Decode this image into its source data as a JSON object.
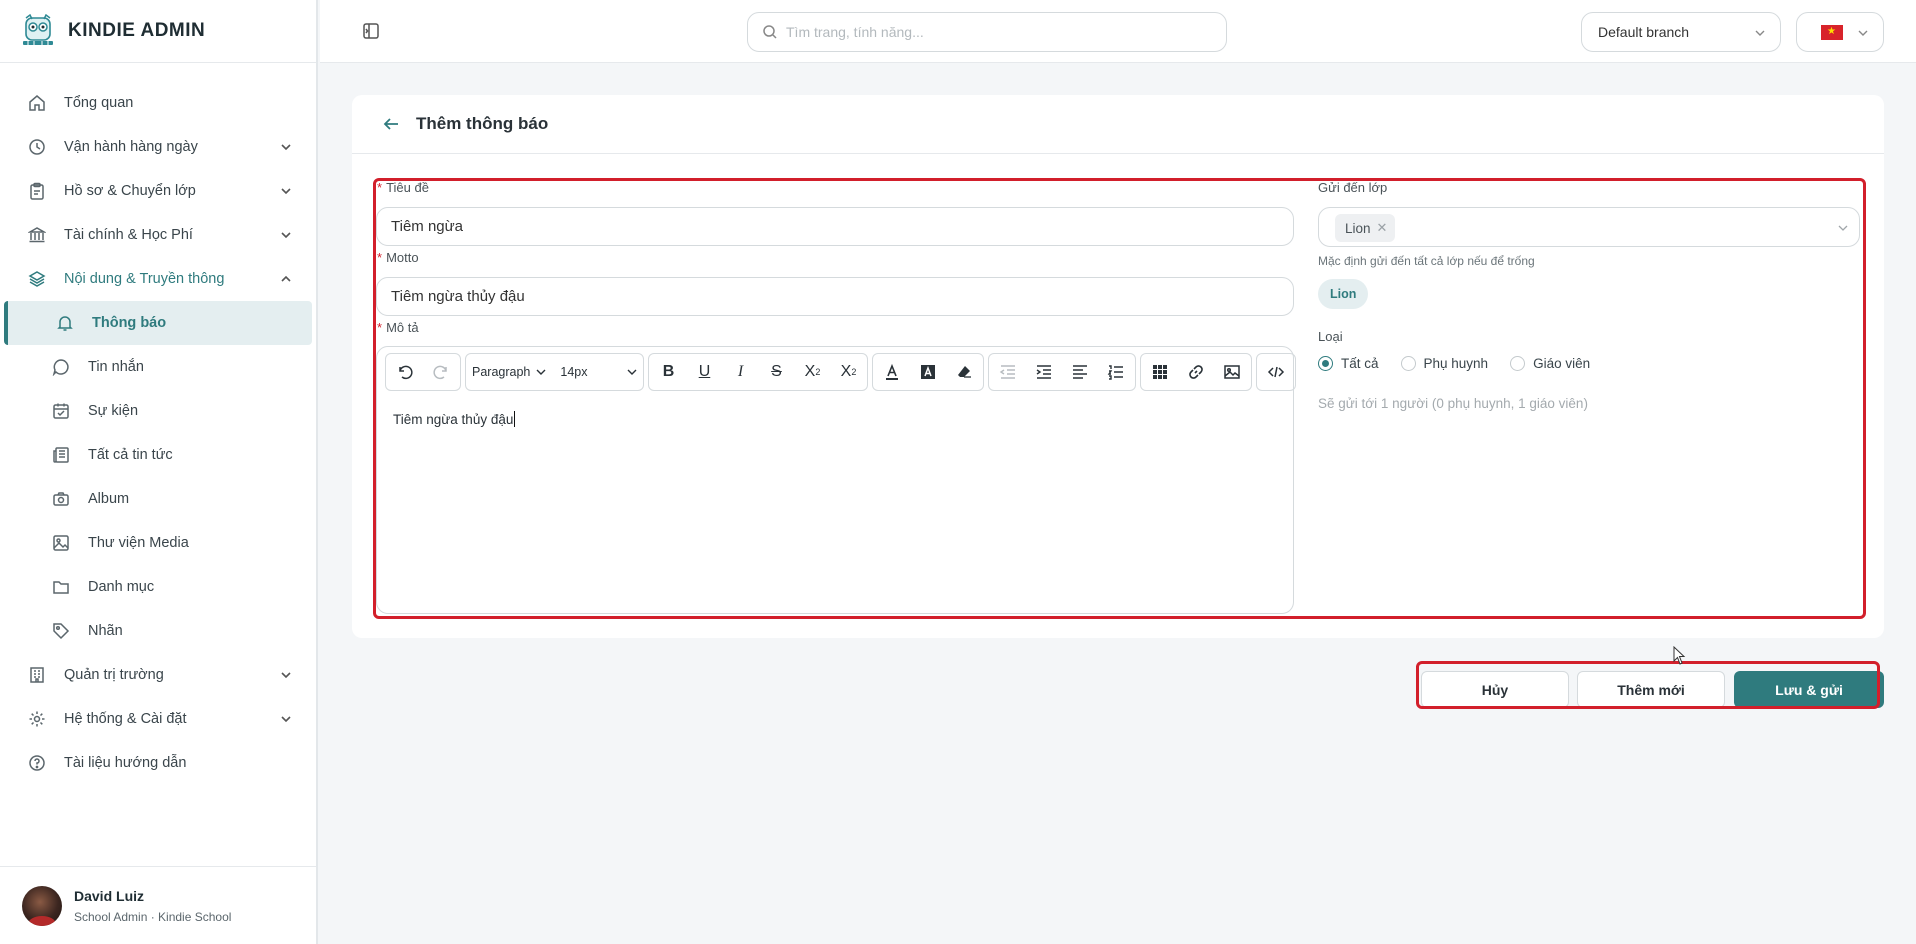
{
  "app": {
    "name": "KINDIE ADMIN"
  },
  "sidebar": {
    "items": [
      {
        "label": "Tổng quan",
        "icon": "home-icon",
        "expandable": false
      },
      {
        "label": "Vận hành hàng ngày",
        "icon": "clock-icon",
        "expandable": true
      },
      {
        "label": "Hồ sơ & Chuyển lớp",
        "icon": "clipboard-icon",
        "expandable": true
      },
      {
        "label": "Tài chính & Học Phí",
        "icon": "bank-icon",
        "expandable": true
      },
      {
        "label": "Nội dung & Truyền thông",
        "icon": "layers-icon",
        "expandable": true,
        "open": true
      }
    ],
    "sub_items": [
      {
        "label": "Thông báo",
        "icon": "bell-icon",
        "active": true
      },
      {
        "label": "Tin nhắn",
        "icon": "message-icon"
      },
      {
        "label": "Sự kiện",
        "icon": "calendar-icon"
      },
      {
        "label": "Tất cả tin tức",
        "icon": "newspaper-icon"
      },
      {
        "label": "Album",
        "icon": "camera-icon"
      },
      {
        "label": "Thư viện Media",
        "icon": "image-icon"
      },
      {
        "label": "Danh mục",
        "icon": "folder-icon"
      },
      {
        "label": "Nhãn",
        "icon": "tag-icon"
      }
    ],
    "bottom_items": [
      {
        "label": "Quản trị trường",
        "icon": "building-icon",
        "expandable": true
      },
      {
        "label": "Hệ thống & Cài đặt",
        "icon": "gear-icon",
        "expandable": true
      },
      {
        "label": "Tài liệu hướng dẫn",
        "icon": "help-circle-icon",
        "expandable": false
      }
    ],
    "user": {
      "name": "David Luiz",
      "role": "School Admin · Kindie School"
    }
  },
  "topbar": {
    "search_placeholder": "Tìm trang, tính năng...",
    "branch": "Default branch",
    "language_flag": "vietnam-flag-icon"
  },
  "form": {
    "title": "Thêm thông báo",
    "title_label": "Tiêu đề",
    "title_value": "Tiêm ngừa",
    "motto_label": "Motto",
    "motto_value": "Tiêm ngừa thủy đậu",
    "description_label": "Mô tả",
    "editor": {
      "block_format": "Paragraph",
      "font_size": "14px",
      "content": "Tiêm ngừa thủy đậu"
    },
    "send_to_label": "Gửi đến lớp",
    "selected_classes": [
      "Lion"
    ],
    "send_to_hint": "Mặc định gửi đến tất cả lớp nếu để trống",
    "class_tag": "Lion",
    "type_label": "Loại",
    "type_options": [
      "Tất cả",
      "Phụ huynh",
      "Giáo viên"
    ],
    "type_selected": "Tất cả",
    "recipients_note": "Sẽ gửi tới 1 người (0 phụ huynh, 1 giáo viên)"
  },
  "actions": {
    "cancel": "Hủy",
    "add_new": "Thêm mới",
    "save_send": "Lưu & gửi"
  },
  "colors": {
    "accent": "#2f7b7e",
    "highlight_box": "#d21f2b"
  }
}
